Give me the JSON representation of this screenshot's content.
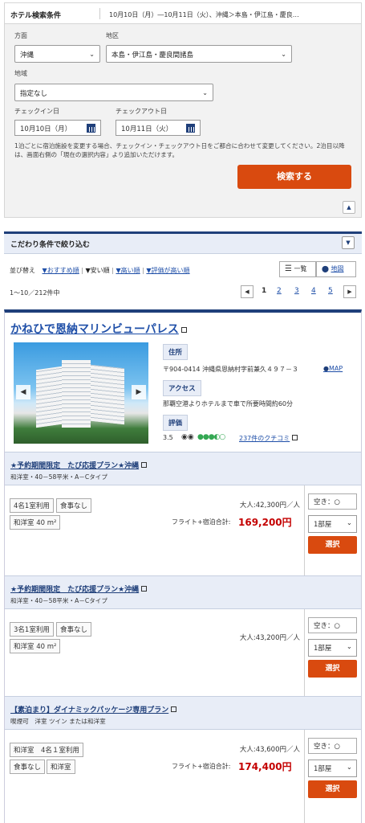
{
  "search": {
    "header_title": "ホテル検索条件",
    "header_summary": "10月10日（月）―10月11日（火）、沖縄＞本島・伊江島・慶良…",
    "direction_label": "方面",
    "direction_value": "沖縄",
    "area_label": "地区",
    "area_value": "本島・伊江島・慶良間諸島",
    "region_label": "地域",
    "region_value": "指定なし",
    "checkin_label": "チェックイン日",
    "checkin_value": "10月10日（月）",
    "checkout_label": "チェックアウト日",
    "checkout_value": "10月11日（火）",
    "note": "1泊ごとに宿泊施設を変更する場合、チェックイン・チェックアウト日をご都合に合わせて変更してください。2泊目以降は、画面右側の「現在の選択内容」より追加いただけます。",
    "search_button": "検索する"
  },
  "filter": {
    "title": "こだわり条件で絞り込む"
  },
  "sort": {
    "label": "並び替え",
    "options": [
      "▼おすすめ順",
      "▼安い順",
      "▼高い順",
      "▼評価が高い順"
    ],
    "view_list": "一覧",
    "view_map": "地図"
  },
  "results": {
    "count": "1～10／212件中",
    "pages": [
      "1",
      "2",
      "3",
      "4",
      "5"
    ]
  },
  "hotel": {
    "name": "かねひで恩納マリンビューパレス",
    "address_label": "住所",
    "address": "〒904-0414 沖縄県恩納村字前兼久４９７－３",
    "map_link": "MAP",
    "access_label": "アクセス",
    "access": "那覇空港よりホテルまで車で所要時間約60分",
    "rating_label": "評価",
    "rating_score": "3.5",
    "review_link": "237件のクチコミ",
    "rating_dots": 3.5
  },
  "plans": [
    {
      "title": "★予約期間限定　たび応援プラン★沖縄",
      "subtitle": "和洋室・40－58平米・A－Cタイプ",
      "chips_row1": [
        "4名1室利用",
        "食事なし"
      ],
      "chips_row2": [
        "和洋室 40 m²"
      ],
      "adult_price": "大人:42,300円／人",
      "total_label": "フライト+宿泊合計:",
      "total_price": "169,200円",
      "availability": "空き：○",
      "rooms": "1部屋",
      "select": "選択"
    },
    {
      "title": "★予約期間限定　たび応援プラン★沖縄",
      "subtitle": "和洋室・40－58平米・A－Cタイプ",
      "chips_row1": [
        "3名1室利用",
        "食事なし"
      ],
      "chips_row2": [
        "和洋室 40 m²"
      ],
      "adult_price": "大人:43,200円／人",
      "availability": "空き：○",
      "rooms": "1部屋",
      "select": "選択"
    },
    {
      "title": "【素泊まり】ダイナミックパッケージ専用プラン",
      "subtitle": "喫煙可　洋室 ツイン または和洋室",
      "chips_row1": [
        "和洋室　4名１室利用"
      ],
      "chips_row2": [
        "食事なし",
        "和洋室"
      ],
      "adult_price": "大人:43,600円／人",
      "total_label": "フライト+宿泊合計:",
      "total_price": "174,400円",
      "availability": "空き：○",
      "rooms": "1部屋",
      "select": "選択"
    }
  ]
}
